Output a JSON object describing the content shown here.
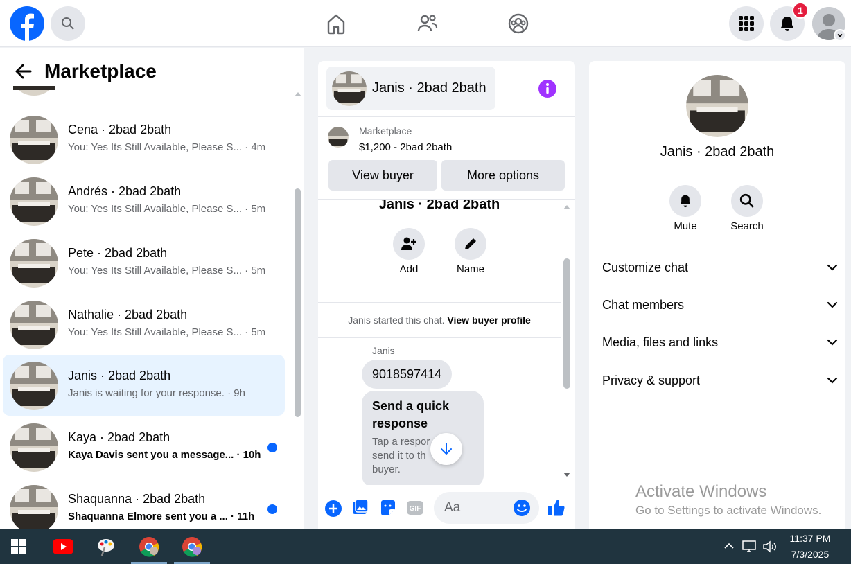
{
  "topbar": {
    "notification_count": "1",
    "brand_color": "#0866ff"
  },
  "sidebar": {
    "title": "Marketplace",
    "conversations": [
      {
        "name": "Cena · 2bad 2bath",
        "message": "You: Yes Its Still Available, Please S... · 4m",
        "unread": false,
        "active": false
      },
      {
        "name": "Andrés · 2bad 2bath",
        "message": "You: Yes Its Still Available, Please S... · 5m",
        "unread": false,
        "active": false
      },
      {
        "name": "Pete · 2bad 2bath",
        "message": "You: Yes Its Still Available, Please S... · 5m",
        "unread": false,
        "active": false
      },
      {
        "name": "Nathalie · 2bad 2bath",
        "message": "You: Yes Its Still Available, Please S... · 5m",
        "unread": false,
        "active": false
      },
      {
        "name": "Janis · 2bad 2bath",
        "message": "Janis is waiting for your response. · 9h",
        "unread": false,
        "active": true
      },
      {
        "name": "Kaya · 2bad 2bath",
        "message": "Kaya Davis sent you a message... · 10h",
        "unread": true,
        "active": false
      },
      {
        "name": "Shaquanna · 2bad 2bath",
        "message": "Shaquanna Elmore sent you a ... · 11h",
        "unread": true,
        "active": false
      }
    ]
  },
  "chat": {
    "header_name": "Janis · 2bad 2bath",
    "marketplace_label": "Marketplace",
    "listing": "$1,200 - 2bad 2bath",
    "view_buyer_label": "View buyer",
    "more_options_label": "More options",
    "group_name": "Janis · 2bad 2bath",
    "add_label": "Add",
    "name_label": "Name",
    "started_text": "Janis started this chat.",
    "view_profile_link": "View buyer profile",
    "sender_label": "Janis",
    "message_text": "9018597414",
    "quick_title": "Send a quick response",
    "quick_body": "Tap a respor send it to th buyer.",
    "composer_placeholder": "Aa"
  },
  "right_panel": {
    "name": "Janis · 2bad 2bath",
    "mute_label": "Mute",
    "search_label": "Search",
    "sections": [
      "Customize chat",
      "Chat members",
      "Media, files and links",
      "Privacy & support"
    ]
  },
  "watermark": {
    "line1": "Activate Windows",
    "line2": "Go to Settings to activate Windows."
  },
  "taskbar": {
    "time": "11:37 PM",
    "date": "7/3/2025"
  }
}
